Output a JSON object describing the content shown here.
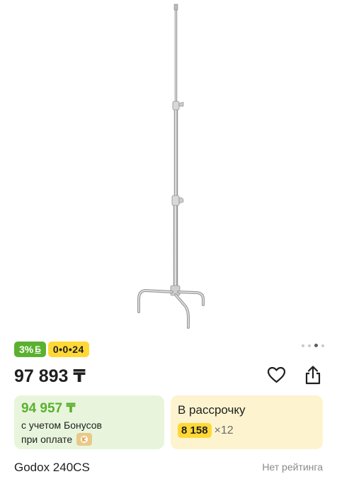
{
  "gallery": {
    "image_description_icon": "c-stand-photo",
    "dots_total": 4,
    "dots_active_index": 2
  },
  "badges": {
    "bonus_percent": "3%",
    "bonus_sign": "Б",
    "installment": "0•0•24"
  },
  "price": {
    "main": "97 893 ₸"
  },
  "actions": {
    "favorite_icon": "heart-icon",
    "share_icon": "share-icon"
  },
  "bonus_card": {
    "price": "94 957 ₸",
    "note": "с учетом Бонусов",
    "pay_label": "при оплате",
    "pay_logo_icon": "kaspi-logo-icon"
  },
  "credit_card": {
    "title": "В рассрочку",
    "amount": "8 158",
    "multiplier": "×12"
  },
  "product": {
    "name": "Godox 240CS",
    "rating": "Нет рейтинга"
  },
  "colors": {
    "green": "#5bb12f",
    "yellow": "#ffd835",
    "bonus_bg": "#e8f5dc",
    "credit_bg": "#fdf4cf"
  }
}
